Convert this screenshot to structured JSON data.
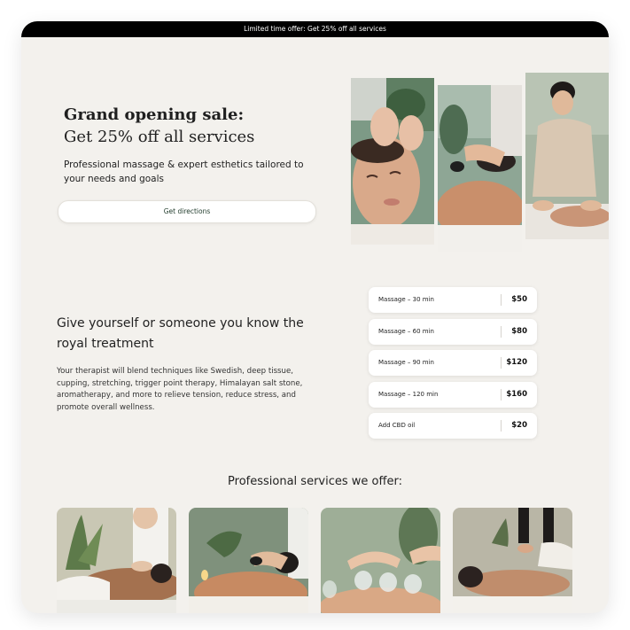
{
  "promo_bar": {
    "text": "Limited time offer: Get 25% off all services"
  },
  "hero": {
    "title_line1": "Grand opening sale:",
    "title_line2": "Get 25% off all services",
    "subtitle": "Professional massage & expert esthetics tailored to your needs and goals",
    "button_label": "Get directions"
  },
  "treatment": {
    "title": "Give yourself or someone you know the royal treatment",
    "body": "Your therapist will blend techniques like Swedish, deep tissue, cupping, stretching, trigger point therapy, Himalayan salt stone, aromatherapy, and more to relieve tension, reduce stress, and promote overall wellness."
  },
  "prices": [
    {
      "name": "Massage – 30 min",
      "price": "$50"
    },
    {
      "name": "Massage – 60 min",
      "price": "$80"
    },
    {
      "name": "Massage – 90 min",
      "price": "$120"
    },
    {
      "name": "Massage – 120 min",
      "price": "$160"
    },
    {
      "name": "Add CBD oil",
      "price": "$20"
    }
  ],
  "services": {
    "title": "Professional services we offer:"
  },
  "colors": {
    "page_background": "#f3f1ed",
    "promo_bar_background": "#000000",
    "card_background": "#ffffff",
    "button_text": "#1f3a2a"
  }
}
